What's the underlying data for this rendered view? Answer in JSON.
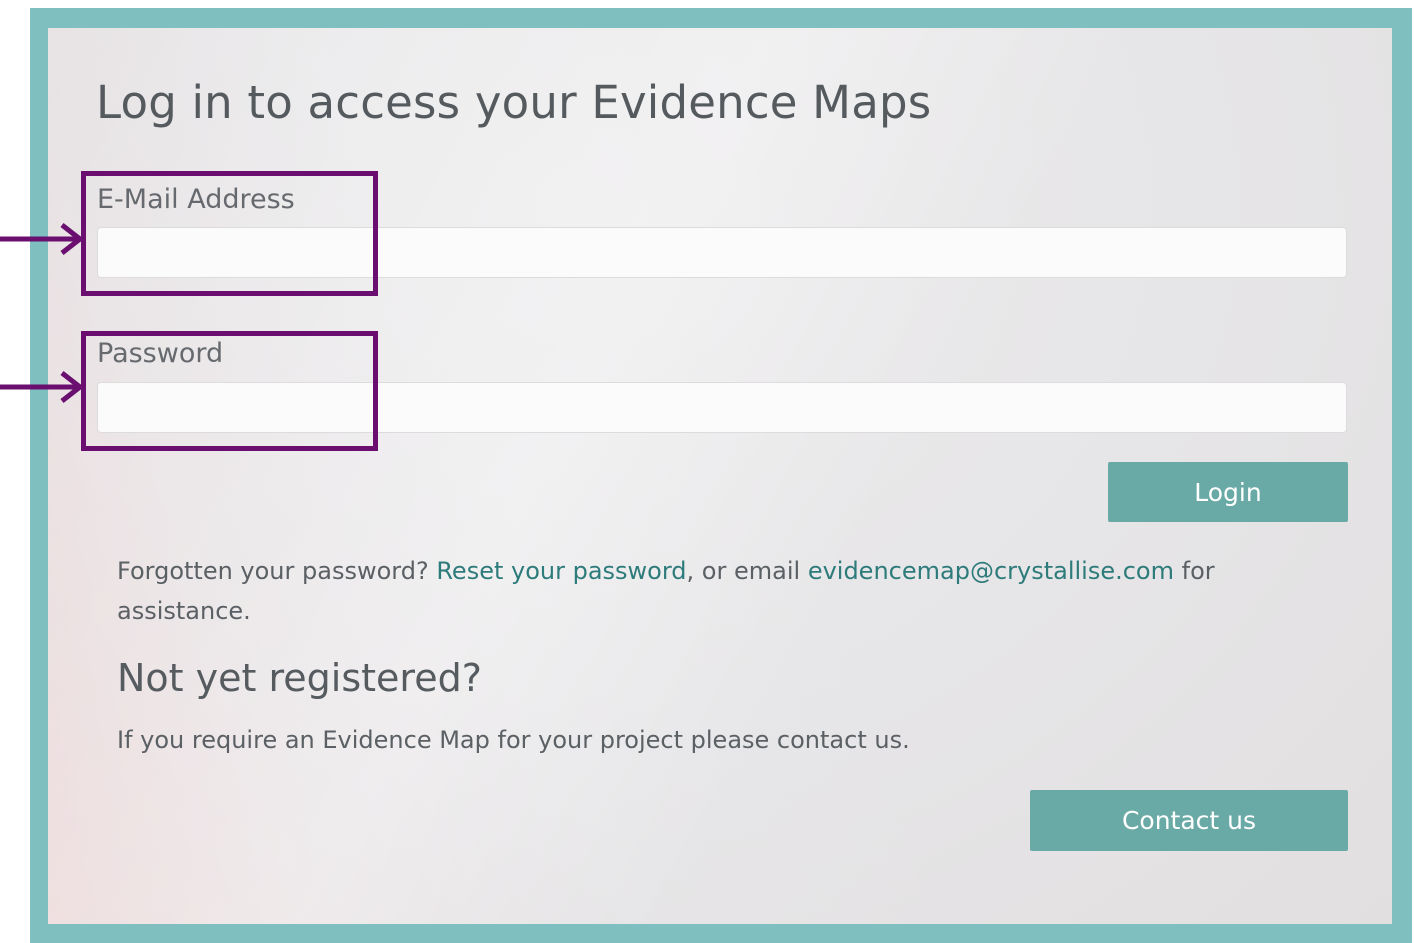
{
  "login": {
    "title": "Log in to access your Evidence Maps",
    "email_label": "E-Mail Address",
    "email_value": "",
    "password_label": "Password",
    "password_value": "",
    "login_button": "Login"
  },
  "help": {
    "prefix": "Forgotten your password? ",
    "reset_link": "Reset your password",
    "middle": ", or email ",
    "email_link": "evidencemap@crystallise.com",
    "suffix": " for assistance."
  },
  "register": {
    "heading": "Not yet registered?",
    "text": "If you require an Evidence Map for your project please contact us.",
    "contact_button": "Contact us"
  },
  "colors": {
    "accent": "#6aaaa6",
    "frame": "#7fbfbf",
    "link": "#2e7b7b",
    "annotation": "#6a0f6f"
  },
  "annotations": {
    "marker_icon": "arrow-right-icon"
  }
}
